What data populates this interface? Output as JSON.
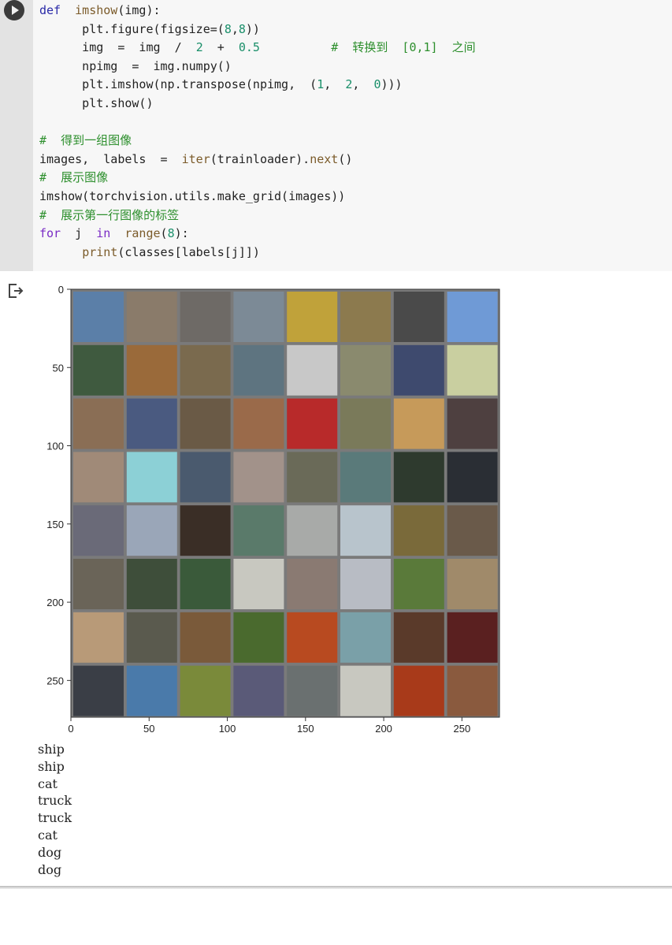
{
  "code_cell": {
    "lines": [
      [
        {
          "t": "def",
          "c": "kw-blue"
        },
        {
          "t": "  "
        },
        {
          "t": "imshow",
          "c": "fn"
        },
        {
          "t": "(img):"
        }
      ],
      [
        {
          "t": "      plt.figure(figsize=("
        },
        {
          "t": "8",
          "c": "num"
        },
        {
          "t": ","
        },
        {
          "t": "8",
          "c": "num"
        },
        {
          "t": "))"
        }
      ],
      [
        {
          "t": "      img  =  img  /  "
        },
        {
          "t": "2",
          "c": "num"
        },
        {
          "t": "  +  "
        },
        {
          "t": "0.5",
          "c": "num"
        },
        {
          "t": "          "
        },
        {
          "t": "#  转换到  [0,1]  之间",
          "c": "cm"
        }
      ],
      [
        {
          "t": "      npimg  =  img.numpy()"
        }
      ],
      [
        {
          "t": "      plt.imshow(np.transpose(npimg,  ("
        },
        {
          "t": "1",
          "c": "num"
        },
        {
          "t": ",  "
        },
        {
          "t": "2",
          "c": "num"
        },
        {
          "t": ",  "
        },
        {
          "t": "0",
          "c": "num"
        },
        {
          "t": ")))"
        }
      ],
      [
        {
          "t": "      plt.show()"
        }
      ],
      [
        {
          "t": ""
        }
      ],
      [
        {
          "t": "#  得到一组图像",
          "c": "cm"
        }
      ],
      [
        {
          "t": "images,  labels  =  "
        },
        {
          "t": "iter",
          "c": "fn"
        },
        {
          "t": "(trainloader)."
        },
        {
          "t": "next",
          "c": "fn"
        },
        {
          "t": "()"
        }
      ],
      [
        {
          "t": "#  展示图像",
          "c": "cm"
        }
      ],
      [
        {
          "t": "imshow(torchvision.utils.make_grid(images))"
        }
      ],
      [
        {
          "t": "#  展示第一行图像的标签",
          "c": "cm"
        }
      ],
      [
        {
          "t": "for",
          "c": "kw"
        },
        {
          "t": "  j  "
        },
        {
          "t": "in",
          "c": "kw"
        },
        {
          "t": "  "
        },
        {
          "t": "range",
          "c": "fn"
        },
        {
          "t": "("
        },
        {
          "t": "8",
          "c": "num"
        },
        {
          "t": "):"
        }
      ],
      [
        {
          "t": "      "
        },
        {
          "t": "print",
          "c": "fn"
        },
        {
          "t": "(classes[labels[j]])"
        }
      ]
    ]
  },
  "icons": {
    "run": "play-icon",
    "output": "output-arrow-icon"
  },
  "image_grid": {
    "x_ticks": [
      "0",
      "50",
      "100",
      "150",
      "200",
      "250"
    ],
    "y_ticks": [
      "0",
      "50",
      "100",
      "150",
      "200",
      "250"
    ],
    "rows": 8,
    "cols": 8
  },
  "output_lines": [
    "ship",
    "ship",
    "cat",
    "truck",
    "truck",
    "cat",
    "dog",
    "dog"
  ]
}
